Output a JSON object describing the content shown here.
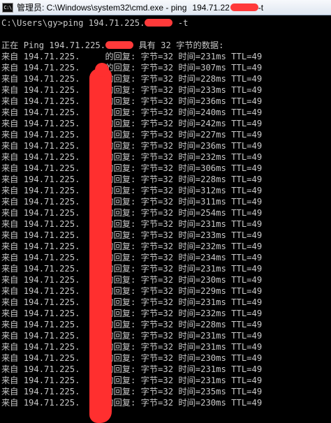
{
  "window": {
    "title": "管理员: C:\\Windows\\system32\\cmd.exe - ping",
    "title_ip": "194.71.22",
    "title_suffix": "-t",
    "icon_text": "C:\\",
    "redaction_color": "#ff3a3a"
  },
  "console": {
    "prompt": "C:\\Users\\gy>",
    "command": "ping 194.71.225.",
    "command_suffix": " -t",
    "header_prefix": "正在 Ping 194.71.225.",
    "header_suffix": " 具有 32 字节的数据:",
    "reply_prefix": "来自 194.71.225.",
    "reply_bytes": "的回复: 字节=32 ",
    "reply_ttl": " TTL=49",
    "times": [
      "时间=231ms",
      "时间=307ms",
      "时间=228ms",
      "时间=233ms",
      "时间=236ms",
      "时间=240ms",
      "时间=242ms",
      "时间=227ms",
      "时间=236ms",
      "时间=232ms",
      "时间=306ms",
      "时间=228ms",
      "时间=312ms",
      "时间=311ms",
      "时间=254ms",
      "时间=231ms",
      "时间=233ms",
      "时间=232ms",
      "时间=234ms",
      "时间=231ms",
      "时间=230ms",
      "时间=229ms",
      "时间=231ms",
      "时间=232ms",
      "时间=228ms",
      "时间=231ms",
      "时间=231ms",
      "时间=230ms",
      "时间=231ms",
      "时间=231ms",
      "时间=235ms",
      "时间=230ms"
    ],
    "text_color": "#c8c8c8",
    "background_color": "#000000"
  }
}
